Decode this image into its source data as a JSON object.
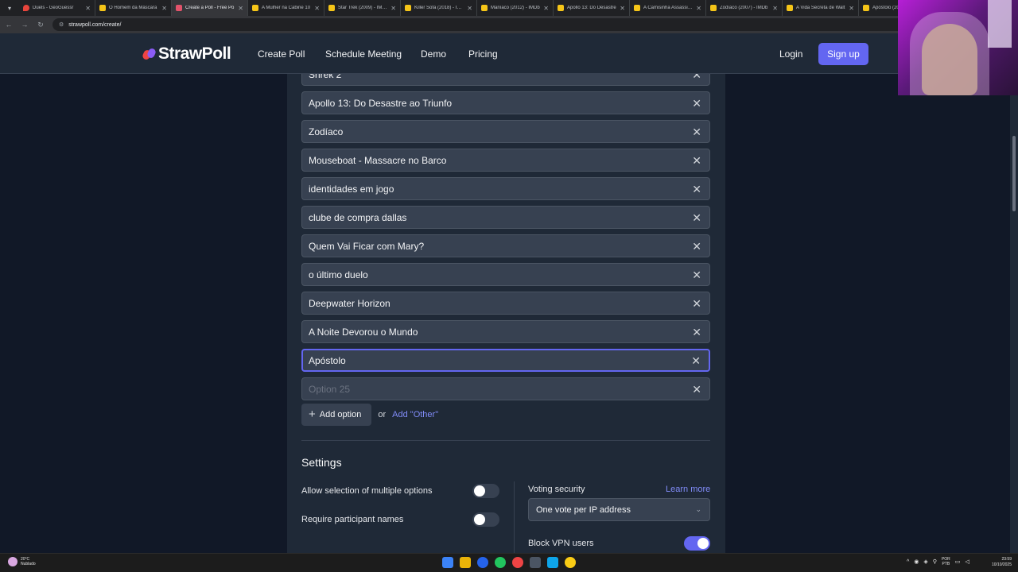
{
  "browser": {
    "tabs": [
      {
        "label": "Duels - GeoGuessr",
        "icon": "geoguessr-icon"
      },
      {
        "label": "O Homem da Máscara",
        "icon": "imdb-icon"
      },
      {
        "label": "Create a Poll - Free Po",
        "icon": "strawpoll-icon",
        "active": true
      },
      {
        "label": "A Mulher na Cabine 10",
        "icon": "imdb-icon"
      },
      {
        "label": "Star Trek (2009) - IMDb",
        "icon": "imdb-icon"
      },
      {
        "label": "Killer Sofa (2018) - IMDb",
        "icon": "imdb-icon"
      },
      {
        "label": "Maníaco (2012) - IMDb",
        "icon": "imdb-icon"
      },
      {
        "label": "Apollo 13: Do Desastre",
        "icon": "imdb-icon"
      },
      {
        "label": "A Camisinha Assassina",
        "icon": "imdb-icon"
      },
      {
        "label": "Zodíaco (2007) - IMDb",
        "icon": "imdb-icon"
      },
      {
        "label": "A Vida Secreta de Walt",
        "icon": "imdb-icon"
      },
      {
        "label": "Apóstolo (201",
        "icon": "imdb-icon"
      }
    ],
    "url": "strawpoll.com/create/"
  },
  "header": {
    "logo_text": "StrawPoll",
    "nav": [
      "Create Poll",
      "Schedule Meeting",
      "Demo",
      "Pricing"
    ],
    "login": "Login",
    "signup": "Sign up"
  },
  "options": [
    {
      "value": "Shrek 2",
      "placeholder": ""
    },
    {
      "value": "Apollo 13: Do Desastre ao Triunfo",
      "placeholder": ""
    },
    {
      "value": "Zodíaco",
      "placeholder": ""
    },
    {
      "value": "Mouseboat - Massacre no Barco",
      "placeholder": ""
    },
    {
      "value": "identidades em jogo",
      "placeholder": ""
    },
    {
      "value": "clube de compra dallas",
      "placeholder": ""
    },
    {
      "value": "Quem Vai Ficar com Mary?",
      "placeholder": ""
    },
    {
      "value": "o último duelo",
      "placeholder": ""
    },
    {
      "value": "Deepwater Horizon",
      "placeholder": ""
    },
    {
      "value": "A Noite Devorou o Mundo",
      "placeholder": ""
    },
    {
      "value": "Apóstolo",
      "placeholder": "",
      "focused": true
    },
    {
      "value": "",
      "placeholder": "Option 25"
    }
  ],
  "add": {
    "add_option": "Add option",
    "or": "or",
    "add_other": "Add \"Other\""
  },
  "settings": {
    "title": "Settings",
    "multiple": {
      "label": "Allow selection of multiple options",
      "enabled": false
    },
    "names": {
      "label": "Require participant names",
      "enabled": false
    },
    "voting_security": {
      "label": "Voting security",
      "learn_more": "Learn more",
      "selected": "One vote per IP address"
    },
    "block_vpn": {
      "label": "Block VPN users",
      "enabled": true
    }
  },
  "taskbar": {
    "weather_temp": "20°C",
    "weather_desc": "Nublado",
    "lang_1": "POR",
    "lang_2": "PTB",
    "time": "23:59",
    "date": "10/10/2025"
  },
  "colors": {
    "accent": "#6366f1",
    "link": "#818cf8",
    "page_bg": "#111827",
    "card_bg": "#1f2937",
    "input_bg": "#374151"
  }
}
